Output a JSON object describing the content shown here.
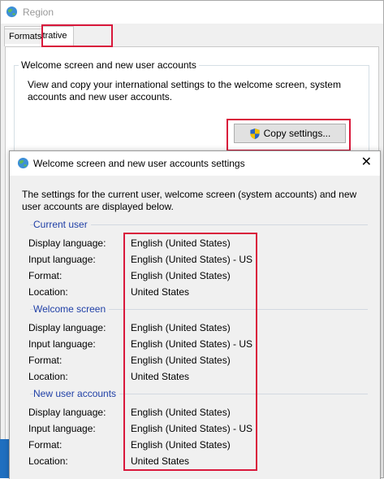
{
  "region_window": {
    "title": "Region",
    "tabs": [
      {
        "label": "Formats",
        "selected": false
      },
      {
        "label": "Administrative",
        "selected": true
      }
    ],
    "welcome_group": {
      "title": "Welcome screen and new user accounts",
      "description": "View and copy your international settings to the welcome screen, system accounts and new user accounts.",
      "copy_button": "Copy settings..."
    }
  },
  "dialog": {
    "title": "Welcome screen and new user accounts settings",
    "intro": "The settings for the current user, welcome screen (system accounts) and new user accounts are displayed below.",
    "sections": [
      {
        "title": "Current user",
        "rows": [
          {
            "label": "Display language:",
            "value": "English (United States)"
          },
          {
            "label": "Input language:",
            "value": "English (United States) - US"
          },
          {
            "label": "Format:",
            "value": "English (United States)"
          },
          {
            "label": "Location:",
            "value": "United States"
          }
        ]
      },
      {
        "title": "Welcome screen",
        "rows": [
          {
            "label": "Display language:",
            "value": "English (United States)"
          },
          {
            "label": "Input language:",
            "value": "English (United States) - US"
          },
          {
            "label": "Format:",
            "value": "English (United States)"
          },
          {
            "label": "Location:",
            "value": "United States"
          }
        ]
      },
      {
        "title": "New user accounts",
        "rows": [
          {
            "label": "Display language:",
            "value": "English (United States)"
          },
          {
            "label": "Input language:",
            "value": "English (United States) - US"
          },
          {
            "label": "Format:",
            "value": "English (United States)"
          },
          {
            "label": "Location:",
            "value": "United States"
          }
        ]
      }
    ]
  },
  "colors": {
    "highlight": "#d9183b",
    "section_title": "#1f3fa6",
    "window_bg": "#f0f0f0"
  },
  "icons": {
    "window": "globe-icon",
    "copy_button": "uac-shield-icon",
    "close": "close-icon"
  }
}
